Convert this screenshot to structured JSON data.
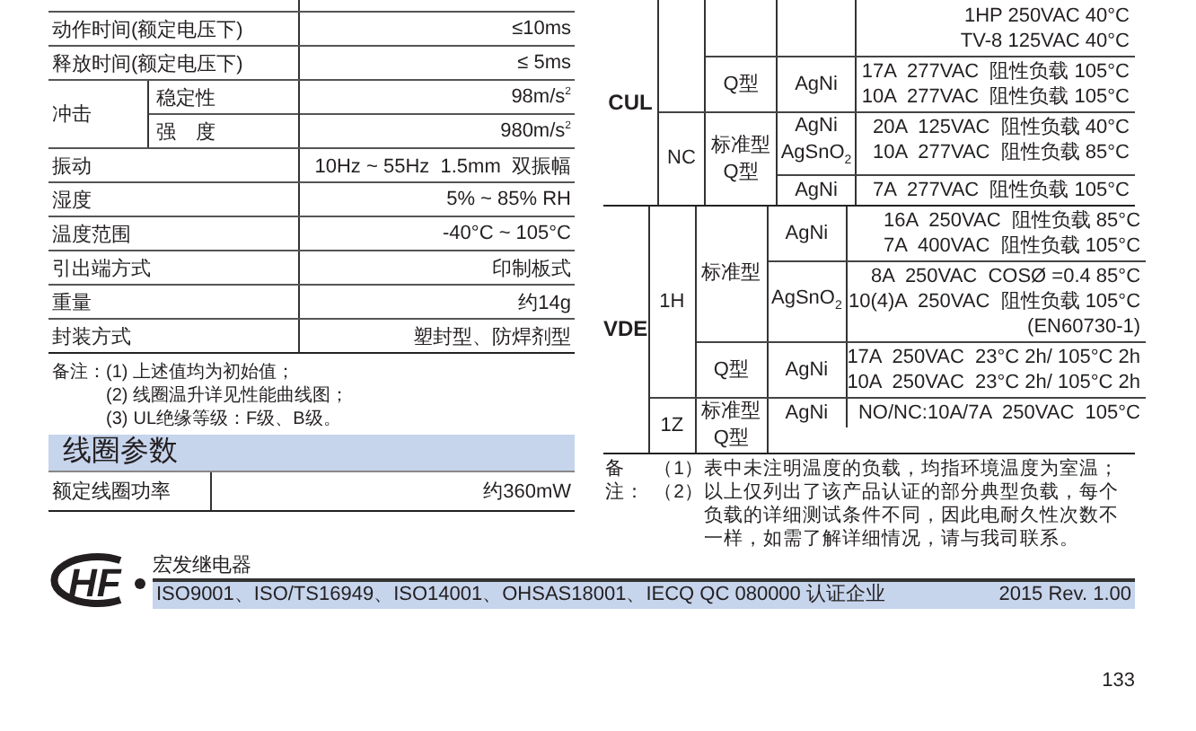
{
  "specs": {
    "rows": [
      {
        "kind": "single",
        "label": "动作时间(额定电压下)",
        "value": "≤10ms"
      },
      {
        "kind": "single",
        "label": "释放时间(额定电压下)",
        "value": "≤ 5ms"
      },
      {
        "kind": "group",
        "label": "冲击",
        "items": [
          {
            "label": "稳定性",
            "value": "98m/s$^{2}$"
          },
          {
            "label": "强　度",
            "value": "980m/s$^{2}$"
          }
        ]
      },
      {
        "kind": "single",
        "label": "振动",
        "value": "10Hz ~ 55Hz  1.5mm  双振幅"
      },
      {
        "kind": "single",
        "label": "湿度",
        "value": "5% ~ 85% RH"
      },
      {
        "kind": "single",
        "label": "温度范围",
        "value": "-40°C ~ 105°C"
      },
      {
        "kind": "single",
        "label": "引出端方式",
        "value": "印制板式"
      },
      {
        "kind": "single",
        "label": "重量",
        "value": "约14g"
      },
      {
        "kind": "single",
        "label": "封装方式",
        "value": "塑封型、防焊剂型"
      }
    ],
    "notes": {
      "label": "备注：",
      "items": [
        {
          "num": "(1)",
          "text": "上述值均为初始值；"
        },
        {
          "num": "(2)",
          "text": "线圈温升详见性能曲线图；"
        },
        {
          "num": "(3)",
          "text": "UL绝缘等级：F级、B级。"
        }
      ]
    }
  },
  "coil": {
    "title": "线圈参数",
    "rows": [
      {
        "label": "额定线圈功率",
        "value": "约360mW"
      }
    ]
  },
  "certs": {
    "rows": [
      {
        "cert": "CUL",
        "contacts": [
          {
            "types": [
              {
                "materials": [
                  {
                    "loads": [
                      "1HP 250VAC 40°C",
                      "TV-8 125VAC 40°C"
                    ]
                  }
                ]
              },
              {
                "type": [
                  "Q型"
                ],
                "materials": [
                  {
                    "material": [
                      "AgNi"
                    ],
                    "loads": [
                      "17A  277VAC  阻性负载 105°C",
                      "10A  277VAC  阻性负载 105°C"
                    ]
                  }
                ]
              }
            ]
          },
          {
            "contact": "NC",
            "types": [
              {
                "type": [
                  "标准型",
                  "Q型"
                ],
                "materials": [
                  {
                    "material": [
                      "AgNi",
                      "AgSnO$_{2}$"
                    ],
                    "loads": [
                      "20A  125VAC  阻性负载 40°C",
                      "10A  277VAC  阻性负载 85°C"
                    ]
                  },
                  {
                    "material": [
                      "AgNi"
                    ],
                    "loads": [
                      "7A  277VAC  阻性负载 105°C"
                    ]
                  }
                ]
              }
            ]
          }
        ]
      },
      {
        "cert": "VDE",
        "contacts": [
          {
            "contact": "1H",
            "types": [
              {
                "type": [
                  "标准型"
                ],
                "materials": [
                  {
                    "material": [
                      "AgNi"
                    ],
                    "loads": [
                      "16A  250VAC  阻性负载 85°C",
                      "7A  400VAC  阻性负载 105°C"
                    ]
                  },
                  {
                    "material": [
                      "AgSnO$_{2}$"
                    ],
                    "loads": [
                      "8A  250VAC  COSØ =0.4 85°C",
                      "10(4)A  250VAC  阻性负载 105°C",
                      "(EN60730-1)"
                    ]
                  }
                ]
              },
              {
                "type": [
                  "Q型"
                ],
                "materials": [
                  {
                    "material": [
                      "AgNi"
                    ],
                    "loads": [
                      "17A  250VAC  23°C 2h/ 105°C 2h",
                      "10A  250VAC  23°C 2h/ 105°C 2h"
                    ]
                  }
                ]
              }
            ]
          },
          {
            "contact": "1Z",
            "types": [
              {
                "type": [
                  "标准型",
                  "Q型"
                ],
                "materials": [
                  {
                    "material": [
                      "AgNi"
                    ],
                    "loads": [
                      "NO/NC:10A/7A  250VAC  105°C"
                    ]
                  }
                ]
              }
            ]
          }
        ]
      }
    ],
    "notes": {
      "label": "备注：",
      "items": [
        {
          "num": "（1）",
          "text": "表中未注明温度的负载，均指环境温度为室温；"
        },
        {
          "num": "（2）",
          "text": "以上仅列出了该产品认证的部分典型负载，每个负载的详细测试条件不同，因此电耐久性次数不一样，如需了解详细情况，请与我司联系。"
        }
      ]
    }
  },
  "footer": {
    "logo": "HF",
    "company": "宏发继电器",
    "certifications": "ISO9001、ISO/TS16949、ISO14001、OHSAS18001、IECQ QC 080000 认证企业",
    "revision": "2015  Rev. 1.00"
  },
  "page_number": "133"
}
